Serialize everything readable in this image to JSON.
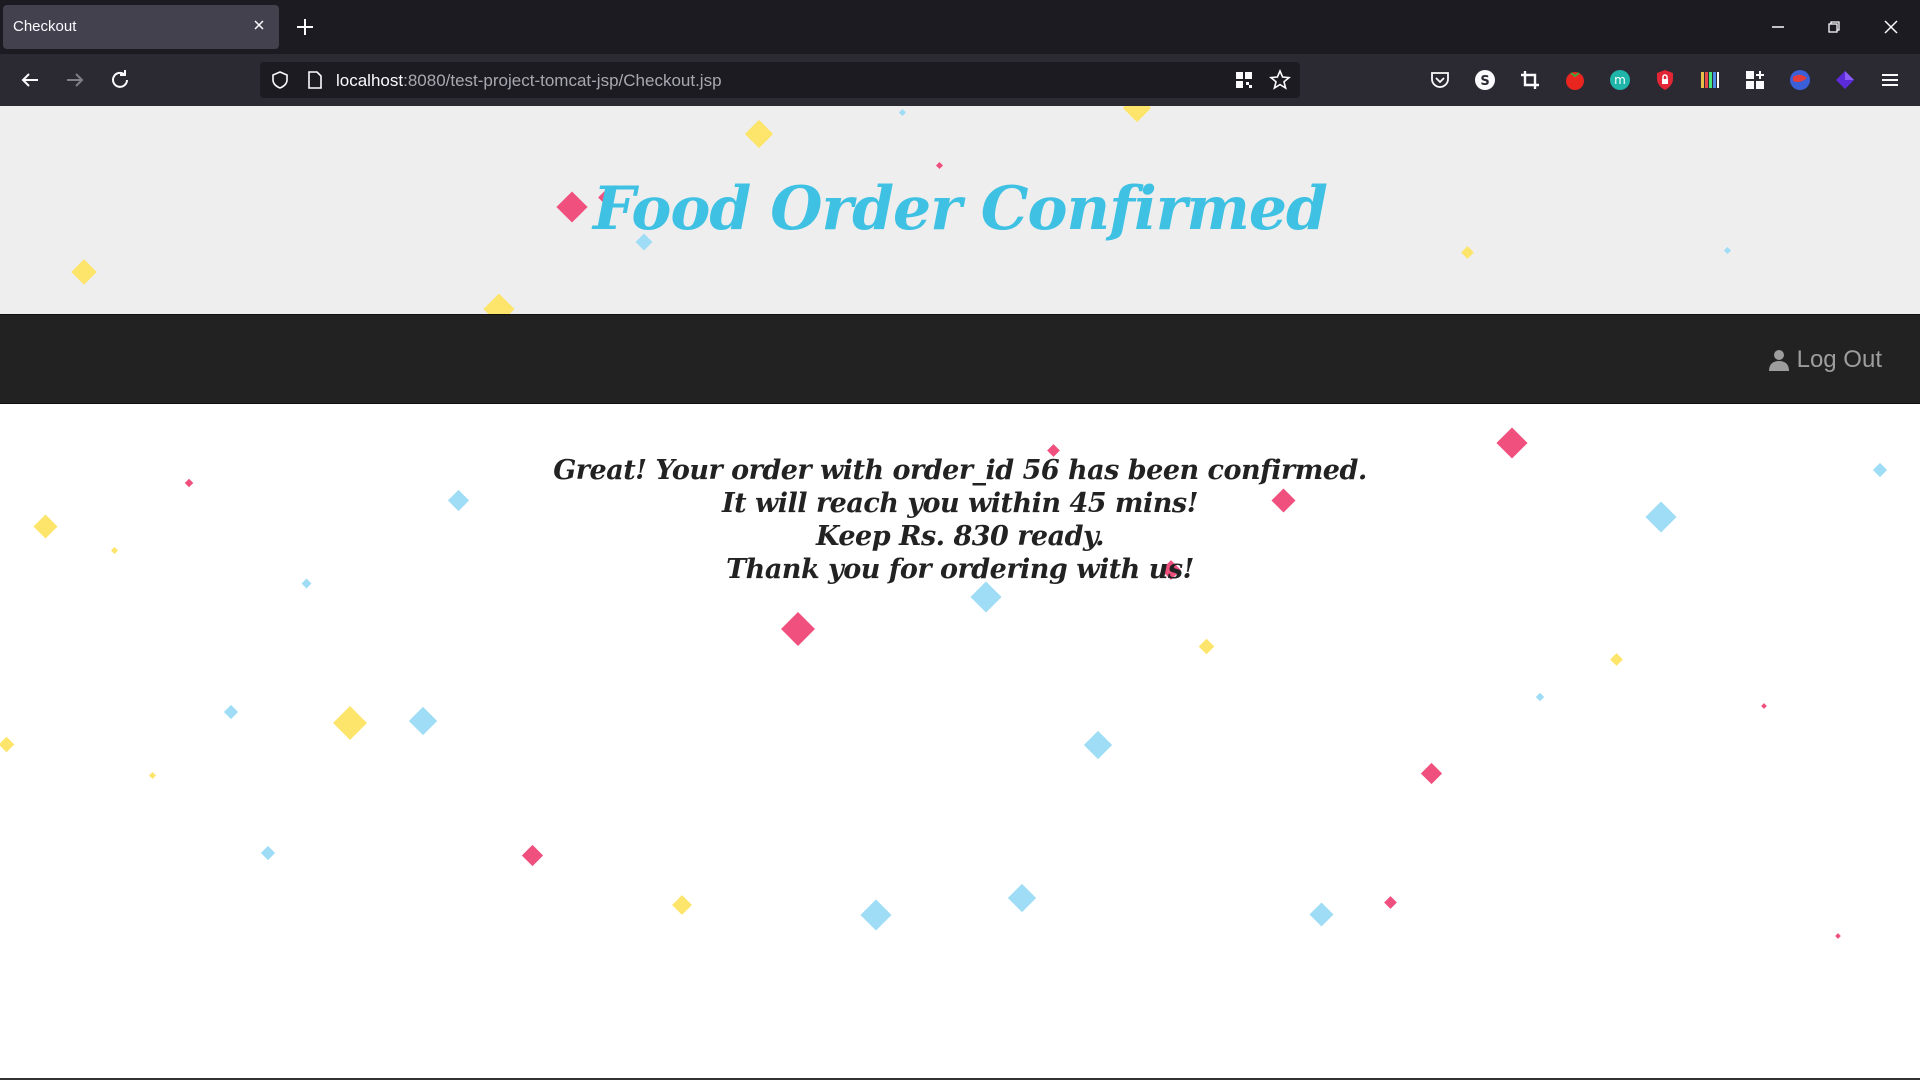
{
  "browser": {
    "tab_title": "Checkout",
    "url_host": "localhost",
    "url_path": ":8080/test-project-tomcat-jsp/Checkout.jsp"
  },
  "header": {
    "title": "Food Order Confirmed"
  },
  "nav": {
    "logout_label": "Log Out"
  },
  "message": {
    "line1": "Great! Your order with order_id 56 has been confirmed.",
    "line2": "It will reach you within 45 mins!",
    "line3": "Keep Rs. 830 ready.",
    "line4": "Thank you for ordering with us!"
  },
  "colors": {
    "title_color": "#3ec1e2",
    "confetti_pink": "#f0507e",
    "confetti_blue": "#9fdcf6",
    "confetti_yellow": "#fde46a"
  },
  "icons": {
    "logout": "user-icon"
  }
}
